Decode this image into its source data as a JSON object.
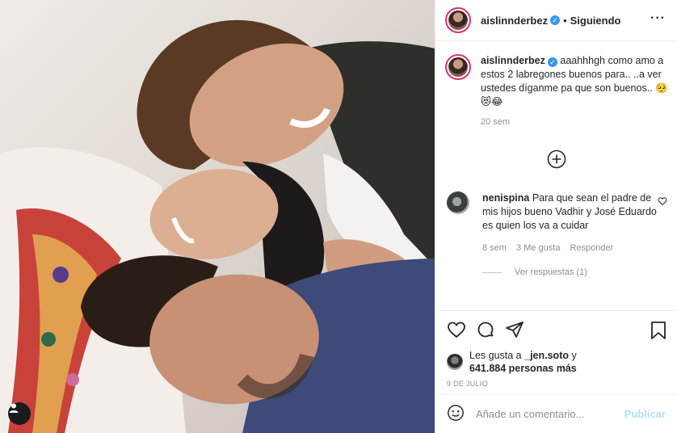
{
  "post": {
    "username": "aislinnderbez",
    "follow_status": "Siguiendo",
    "caption": {
      "text": "aaahhhgh como amo a estos 2 labregones buenos para.. ..a ver ustedes díganme pa que son buenos..",
      "emojis": "🥺😻😂",
      "time": "20 sem"
    },
    "comment": {
      "username": "nenispina",
      "text": "Para que sean el padre de mis hijos bueno Vadhir y José Eduardo es quien los va a cuidar",
      "time": "8 sem",
      "likes": "3 Me gusta",
      "reply_label": "Responder",
      "view_replies": "Ver respuestas (1)"
    },
    "likes": {
      "prefix": "Les gusta a",
      "user": "_jen.soto",
      "joiner": "y",
      "count": "641.884 personas más"
    },
    "date": "9 DE JULIO",
    "add_comment": {
      "placeholder": "Añade un comentario...",
      "publish_label": "Publicar"
    }
  },
  "icons": {
    "verified": "verified-badge-icon",
    "more": "more-options-icon",
    "load_more": "plus-circle-icon",
    "like": "heart-icon",
    "comment": "comment-bubble-icon",
    "share": "paper-plane-icon",
    "save": "bookmark-icon",
    "emoji": "emoji-smile-icon",
    "tags": "user-tag-icon"
  },
  "colors": {
    "verified": "#3897f0",
    "link_disabled": "#b2dffc",
    "secondary_text": "#8e8e8e"
  }
}
